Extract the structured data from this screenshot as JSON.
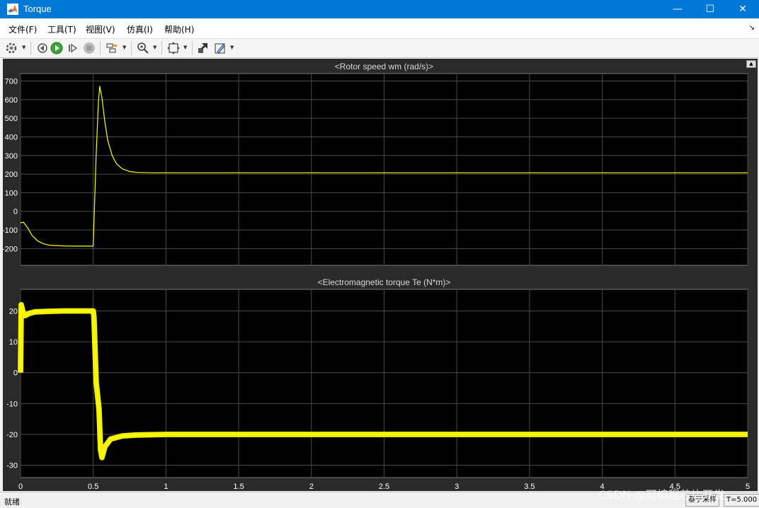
{
  "window": {
    "title": "Torque",
    "minimize_glyph": "—",
    "maximize_glyph": "☐",
    "close_glyph": "✕"
  },
  "menu": {
    "items": [
      {
        "label": "文件(F)"
      },
      {
        "label": "工具(T)"
      },
      {
        "label": "视图(V)"
      },
      {
        "label": "仿真(I)"
      },
      {
        "label": "帮助(H)"
      }
    ],
    "corner_glyph": "↘"
  },
  "toolbar": {
    "icons": [
      "settings-icon",
      "step-back-icon",
      "run-icon",
      "step-forward-icon",
      "stop-icon",
      "signal-select-icon",
      "zoom-icon",
      "fit-view-icon",
      "highlight-icon",
      "style-icon"
    ]
  },
  "colors": {
    "axes_background": "#000000",
    "figure_background": "#2a2a2a",
    "grid": "#4a4a4a",
    "line": "#ffff00",
    "tick_text": "#ffffff",
    "title_text": "#d9d9d9"
  },
  "chart_data": [
    {
      "type": "line",
      "title": "<Rotor speed wm (rad/s)>",
      "xlabel": "",
      "ylabel": "",
      "xlim": [
        0,
        5
      ],
      "ylim": [
        -290,
        740
      ],
      "xticks": [
        0,
        0.5,
        1,
        1.5,
        2,
        2.5,
        3,
        3.5,
        4,
        4.5,
        5
      ],
      "yticks": [
        -200,
        -100,
        0,
        100,
        200,
        300,
        400,
        500,
        600,
        700
      ],
      "grid": true,
      "x": [
        0,
        0.02,
        0.05,
        0.08,
        0.12,
        0.16,
        0.2,
        0.3,
        0.4,
        0.499,
        0.5,
        0.52,
        0.535,
        0.545,
        0.56,
        0.58,
        0.6,
        0.63,
        0.66,
        0.7,
        0.75,
        0.8,
        0.9,
        1,
        2,
        3,
        4,
        5
      ],
      "series": [
        {
          "values": [
            -62,
            -58,
            -90,
            -130,
            -160,
            -175,
            -182,
            -186,
            -187,
            -187,
            -180,
            300,
            580,
            672,
            610,
            480,
            380,
            300,
            255,
            228,
            214,
            209,
            207,
            207,
            207,
            207,
            207,
            207
          ]
        }
      ]
    },
    {
      "type": "line",
      "title": "<Electromagnetic torque Te (N*m)>",
      "xlabel": "",
      "ylabel": "",
      "xlim": [
        0,
        5
      ],
      "ylim": [
        -34,
        27
      ],
      "xticks": [
        0,
        0.5,
        1,
        1.5,
        2,
        2.5,
        3,
        3.5,
        4,
        4.5,
        5
      ],
      "yticks": [
        -30,
        -20,
        -10,
        0,
        10,
        20
      ],
      "xtick_labels": [
        "0",
        "0.5",
        "1",
        "1.5",
        "2",
        "2.5",
        "3",
        "3.5",
        "4",
        "4.5",
        "5"
      ],
      "grid": true,
      "x": [
        0,
        0.005,
        0.015,
        0.03,
        0.06,
        0.1,
        0.2,
        0.3,
        0.4,
        0.5,
        0.505,
        0.52,
        0.54,
        0.55,
        0.56,
        0.58,
        0.62,
        0.7,
        0.8,
        1,
        2,
        3,
        4,
        5
      ],
      "series": [
        {
          "values": [
            0,
            22,
            20,
            18.5,
            19.2,
            19.7,
            19.9,
            20,
            20,
            20,
            18,
            -3,
            -12,
            -25,
            -27.5,
            -24,
            -21.5,
            -20.5,
            -20.2,
            -20,
            -20,
            -20,
            -20,
            -20
          ]
        }
      ],
      "noise_band": 0.9
    }
  ],
  "status": {
    "left": "就绪",
    "sample_mode": "基于采样",
    "time": "T=5.000"
  },
  "watermark": "CSDN @可编程芯片开发"
}
